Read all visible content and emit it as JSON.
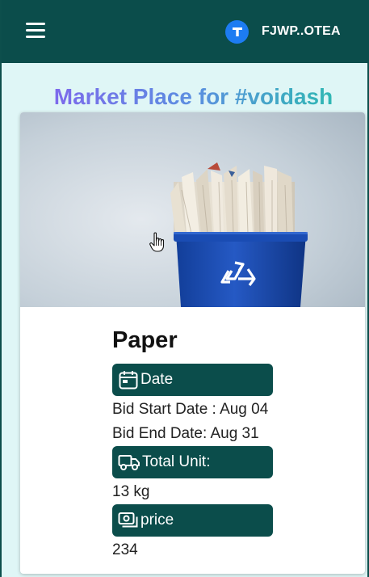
{
  "header": {
    "menu_icon": "hamburger-menu-icon",
    "brand_icon": "t-logo-icon",
    "brand_name": "FJWP..OTEA",
    "brand_color": "#1d7cf2",
    "background": "#0b4d4b"
  },
  "page": {
    "title": "Market Place for #voidash",
    "title_gradient": [
      "#8a5cf0",
      "#5b8fe0",
      "#20c7a3"
    ],
    "background": "#dff6f6"
  },
  "listing": {
    "image_icon": "recycle-bin-with-paper-image",
    "name": "Paper",
    "date_icon": "calendar-icon",
    "date_label": "Date",
    "bid_start": "Bid Start Date : Aug 04",
    "bid_end": "Bid End Date: Aug 31",
    "unit_icon": "truck-icon",
    "unit_label": "Total Unit:",
    "unit_value": "13 kg",
    "price_icon": "cash-icon",
    "price_label": "price",
    "price_value": "234",
    "accent": "#0b4d4b"
  }
}
